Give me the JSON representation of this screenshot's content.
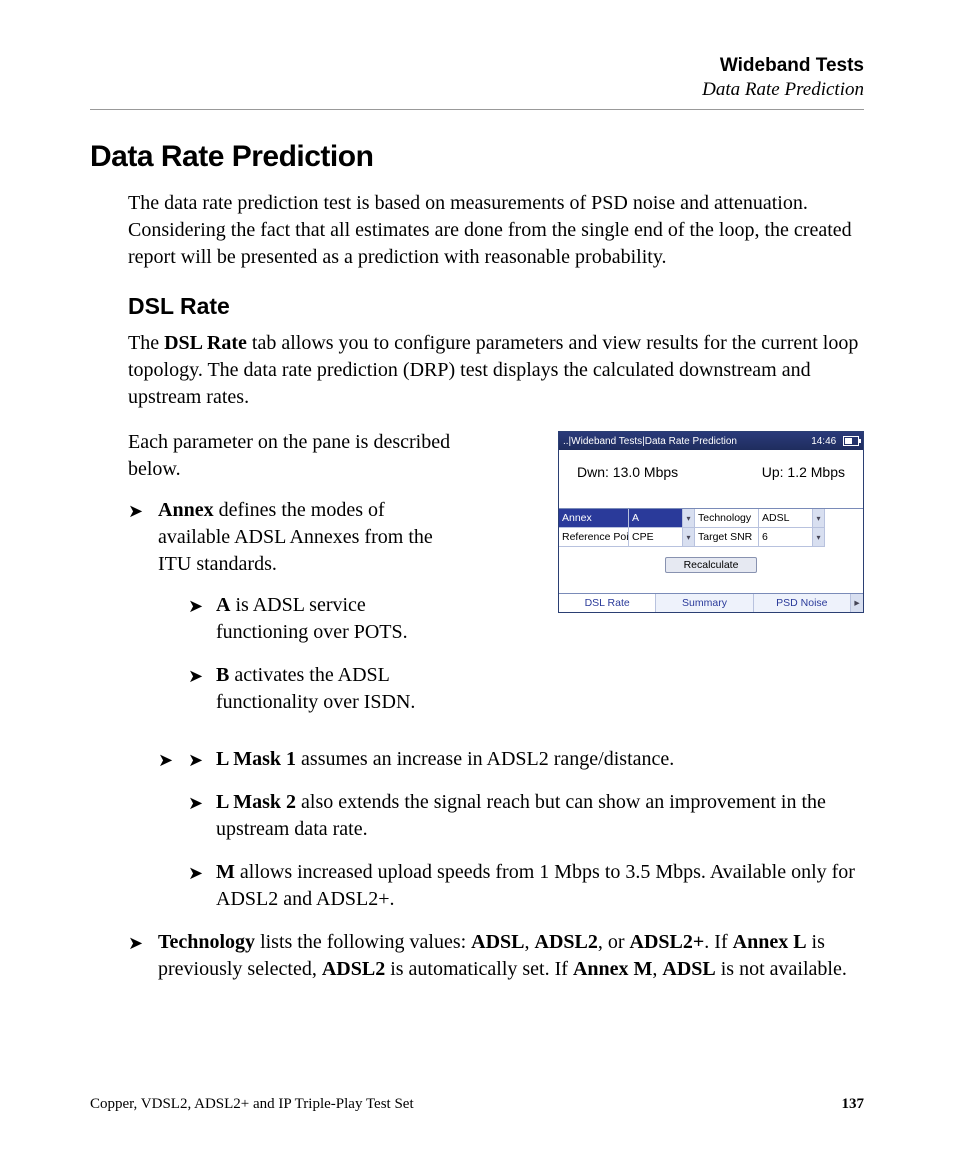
{
  "header": {
    "chapter": "Wideband Tests",
    "section": "Data Rate Prediction"
  },
  "title": "Data Rate Prediction",
  "intro": "The data rate prediction test is based on measurements of PSD noise and attenuation. Considering the fact that all estimates are done from the single end of the loop, the created report will be presented as a prediction with reasonable probability.",
  "dsl": {
    "heading": "DSL Rate",
    "p1_a": "The ",
    "p1_b": "DSL Rate",
    "p1_c": " tab allows you to configure parameters and view results for the current loop topology. The data rate prediction (DRP) test displays the calculated downstream and upstream rates.",
    "p2": "Each parameter on the pane is described below."
  },
  "items": {
    "annex": {
      "b": "Annex",
      "t": " defines the modes of available ADSL Annexes from the ITU standards."
    },
    "a": {
      "b": "A",
      "t": " is ADSL service functioning over POTS."
    },
    "b2": {
      "b": "B",
      "t": " activates the ADSL functionality over ISDN."
    },
    "l1": {
      "b": "L Mask 1",
      "t": " assumes an increase in ADSL2 range/distance."
    },
    "l2": {
      "b": "L Mask 2",
      "t": " also extends the signal reach but can show an improvement in the upstream data rate."
    },
    "m": {
      "b": "M",
      "t": " allows increased upload speeds from 1 Mbps to 3.5 Mbps. Available only for ADSL2 and ADSL2+."
    },
    "tech": {
      "b": "Technology",
      "t1": " lists the following values: ",
      "v1": "ADSL",
      "c1": ", ",
      "v2": "ADSL2",
      "c2": ", or ",
      "v3": "ADSL2+",
      "c3": ". If ",
      "v4": "Annex L",
      "c4": " is previously selected, ",
      "v5": "ADSL2",
      "c5": " is automatically set. If ",
      "v6": "Annex M",
      "c6": ", ",
      "v7": "ADSL",
      "c7": " is not available."
    }
  },
  "device": {
    "breadcrumb": "..|Wideband Tests|Data Rate Prediction",
    "time": "14:46",
    "dwn": "Dwn: 13.0 Mbps",
    "up": "Up: 1.2 Mbps",
    "fields": {
      "annex_label": "Annex",
      "annex_value": "A",
      "tech_label": "Technology",
      "tech_value": "ADSL",
      "ref_label": "Reference Point",
      "ref_value": "CPE",
      "snr_label": "Target SNR",
      "snr_value": "6"
    },
    "recalculate": "Recalculate",
    "tabs": {
      "t1": "DSL Rate",
      "t2": "Summary",
      "t3": "PSD Noise"
    }
  },
  "footer": {
    "left": "Copper, VDSL2, ADSL2+ and IP Triple-Play Test Set",
    "page": "137"
  }
}
